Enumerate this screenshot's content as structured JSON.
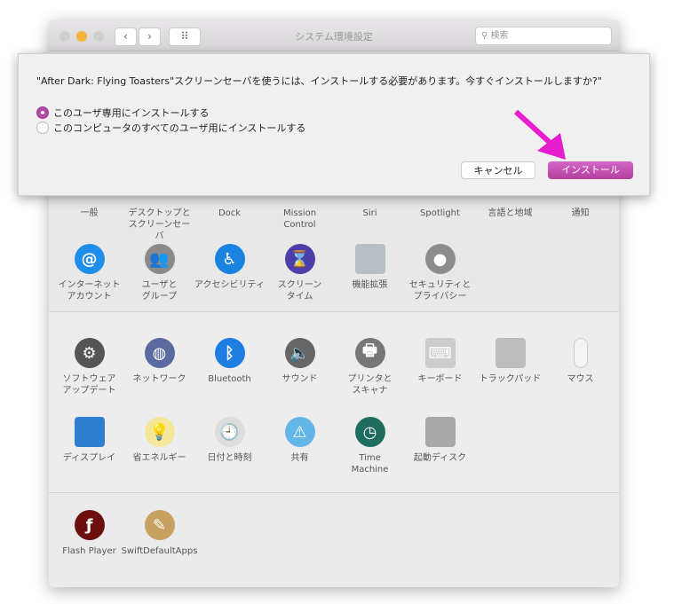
{
  "window": {
    "title": "システム環境設定",
    "search_placeholder": "検索",
    "nav_back": "‹",
    "nav_forward": "›",
    "grid": "⠿"
  },
  "dialog": {
    "message": "\"After Dark: Flying Toasters\"スクリーンセーバを使うには、インストールする必要があります。今すぐインストールしますか?\"",
    "options": [
      {
        "label": "このユーザ専用にインストールする",
        "selected": true
      },
      {
        "label": "このコンピュータのすべてのユーザ用にインストールする",
        "selected": false
      }
    ],
    "cancel": "キャンセル",
    "install": "インストール",
    "accent": "#c04cb8",
    "arrow_color": "#e81ccf"
  },
  "rows": [
    [
      {
        "label": "一般"
      },
      {
        "label": "デスクトップと\nスクリーンセーバ"
      },
      {
        "label": "Dock"
      },
      {
        "label": "Mission\nControl"
      },
      {
        "label": "Siri"
      },
      {
        "label": "Spotlight"
      },
      {
        "label": "言語と地域"
      },
      {
        "label": "通知"
      }
    ],
    [
      {
        "label": "インターネット\nアカウント",
        "icon": "at-icon",
        "glyph": "@",
        "color": "#1e8ee8"
      },
      {
        "label": "ユーザと\nグループ",
        "icon": "users-icon",
        "glyph": "👥",
        "color": "#8a8a8a"
      },
      {
        "label": "アクセシビリティ",
        "icon": "accessibility-icon",
        "glyph": "♿",
        "color": "#1a82e0"
      },
      {
        "label": "スクリーン\nタイム",
        "icon": "hourglass-icon",
        "glyph": "⌛",
        "color": "#4b3ea8"
      },
      {
        "label": "機能拡張",
        "icon": "puzzle-icon",
        "glyph": "",
        "color": "#b8c0c4"
      },
      {
        "label": "セキュリティと\nプライバシー",
        "icon": "house-lock-icon",
        "glyph": "●",
        "color": "#8c8c8c"
      }
    ],
    [
      {
        "label": "ソフトウェア\nアップデート",
        "icon": "gear-icon",
        "glyph": "⚙",
        "color": "#555"
      },
      {
        "label": "ネットワーク",
        "icon": "globe-icon",
        "glyph": "◍",
        "color": "#5a6aa0"
      },
      {
        "label": "Bluetooth",
        "icon": "bluetooth-icon",
        "glyph": "ᛒ",
        "color": "#1e7de0"
      },
      {
        "label": "サウンド",
        "icon": "speaker-icon",
        "glyph": "🔈",
        "color": "#666"
      },
      {
        "label": "プリンタと\nスキャナ",
        "icon": "printer-icon",
        "glyph": "🖶",
        "color": "#777"
      },
      {
        "label": "キーボード",
        "icon": "keyboard-icon",
        "glyph": "⌨",
        "color": "#ccc"
      },
      {
        "label": "トラックパッド",
        "icon": "trackpad-icon",
        "glyph": "",
        "color": "#bdbdbd"
      },
      {
        "label": "マウス",
        "icon": "mouse-icon",
        "glyph": "",
        "color": "#f4f4f4"
      }
    ],
    [
      {
        "label": "ディスプレイ",
        "icon": "display-icon",
        "glyph": "",
        "color": "#2f7fd0"
      },
      {
        "label": "省エネルギー",
        "icon": "lightbulb-icon",
        "glyph": "💡",
        "color": "#f5e79a"
      },
      {
        "label": "日付と時刻",
        "icon": "clock-icon",
        "glyph": "🕘",
        "color": "#ddd"
      },
      {
        "label": "共有",
        "icon": "folder-icon",
        "glyph": "⚠",
        "color": "#62b6e8"
      },
      {
        "label": "Time\nMachine",
        "icon": "time-machine-icon",
        "glyph": "◷",
        "color": "#1f6d5e"
      },
      {
        "label": "起動ディスク",
        "icon": "disk-icon",
        "glyph": "",
        "color": "#a8a8a8"
      }
    ],
    [
      {
        "label": "Flash Player",
        "icon": "flash-icon",
        "glyph": "ƒ",
        "color": "#6b0f0f"
      },
      {
        "label": "SwiftDefaultApps",
        "icon": "swift-apps-icon",
        "glyph": "✎",
        "color": "#c8a060"
      }
    ]
  ]
}
